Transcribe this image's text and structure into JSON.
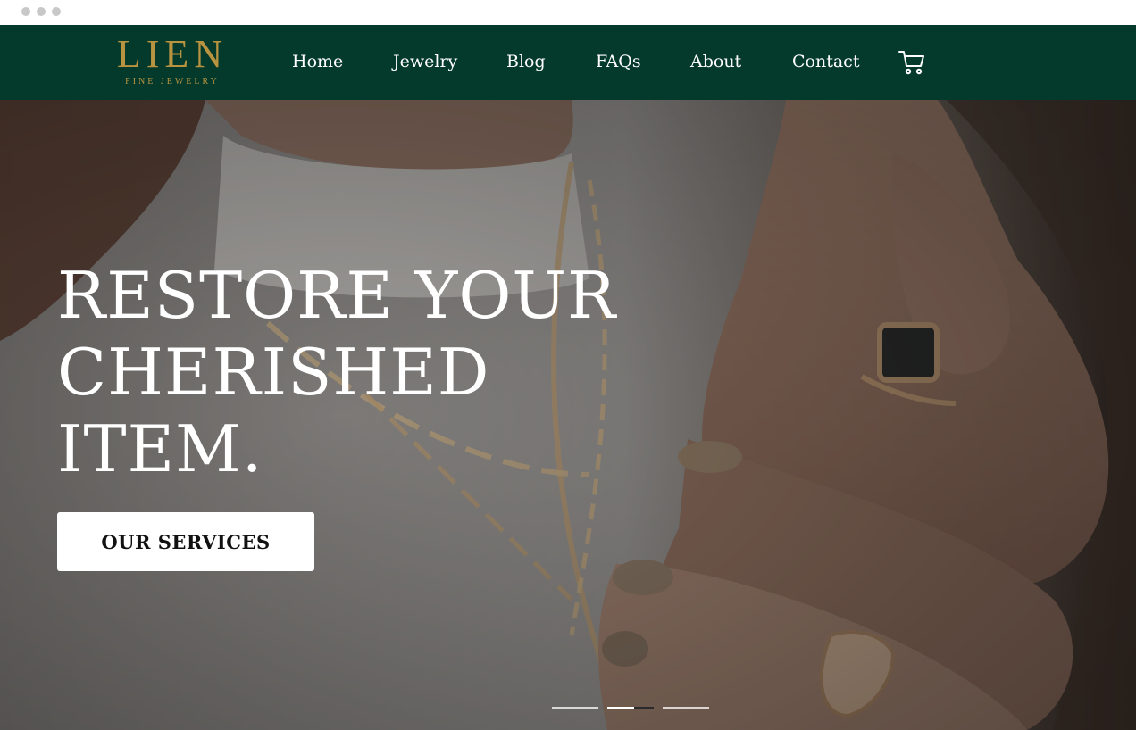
{
  "brand": {
    "name": "LIEN",
    "tagline": "FINE JEWELRY",
    "color": "#b89340"
  },
  "nav": {
    "background": "#043a2b",
    "items": [
      {
        "label": "Home"
      },
      {
        "label": "Jewelry"
      },
      {
        "label": "Blog"
      },
      {
        "label": "FAQs"
      },
      {
        "label": "About"
      },
      {
        "label": "Contact"
      }
    ],
    "cart_icon": "cart-icon"
  },
  "hero": {
    "title_line1": "RESTORE YOUR",
    "title_line2": "CHERISHED",
    "title_line3": "ITEM.",
    "cta_label": "OUR SERVICES",
    "slides_total": 3,
    "active_slide": 2
  }
}
